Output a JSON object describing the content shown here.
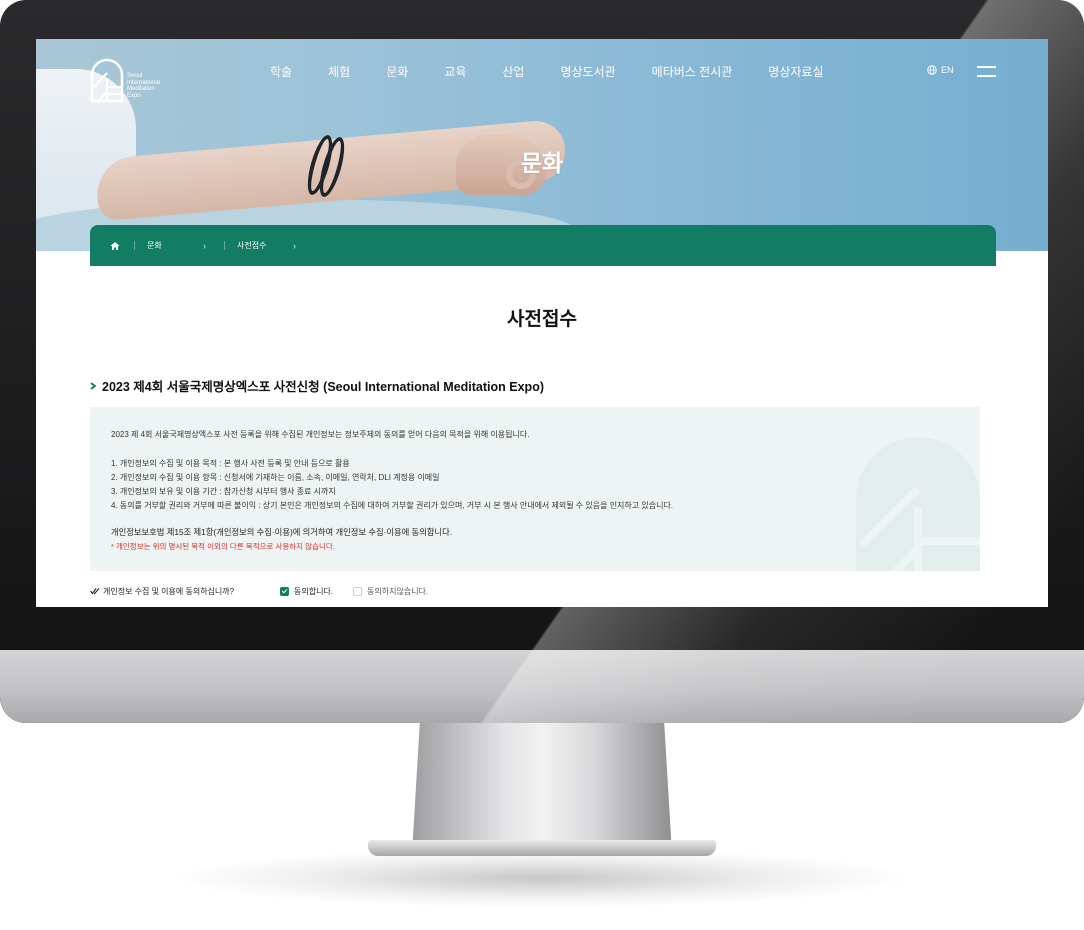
{
  "nav": {
    "items": [
      "학술",
      "체험",
      "문화",
      "교육",
      "산업",
      "명상도서관",
      "메타버스 전시관",
      "명상자료실"
    ],
    "lang": "EN",
    "logo_text": [
      "Seoul",
      "International",
      "Meditation",
      "Expo"
    ]
  },
  "hero": {
    "title": "문화"
  },
  "breadcrumb": {
    "items": [
      "문화",
      "사전접수"
    ]
  },
  "page": {
    "title": "사전접수",
    "section_title": "2023 제4회 서울국제명상엑스포 사전신청 (Seoul International Meditation Expo)"
  },
  "notice": {
    "intro": "2023 제 4회 서울국제명상엑스포 사전 등록을 위해 수집된 개인정보는 정보주체의 동의를 얻어 다음의 목적을 위해 이용됩니다.",
    "items": [
      "1. 개인정보의 수집 및 이용 목적 :  본 행사 사전 등록 및 안내 등으로 활용",
      "2. 개인정보의 수집 및 이용 항목 : 신청서에 기재하는 이름, 소속, 이메일, 연락처, DLI 계정용 이메일",
      "3. 개인정보의 보유 및 이용 기간 : 참가신청 시부터 행사 종료 시까지",
      "4. 동의를 거부할 권리와 거부에 따른 불이익 : 상기 본인은 개인정보의 수집에 대하여 거부할 권리가 있으며, 거부 시 본 행사 안내에서 제외될 수 있음을 인지하고 있습니다."
    ],
    "law": "개인정보보호법 제15조 제1항(개인정보의 수집·이용)에 의거하여 개인정보 수집·이용에 동의합니다.",
    "warning": "* 개인정보는 위의 명시된 목적 이외의 다른 목적으로 사용하지 않습니다."
  },
  "consent": {
    "question": "개인정보 수집 및 이용에 동의하십니까?",
    "agree": "동의합니다.",
    "disagree": "동의하지않습니다.",
    "agree_checked": true
  },
  "colors": {
    "accent": "#137d64",
    "box": "#edf4f3",
    "warning": "#d9302c"
  }
}
